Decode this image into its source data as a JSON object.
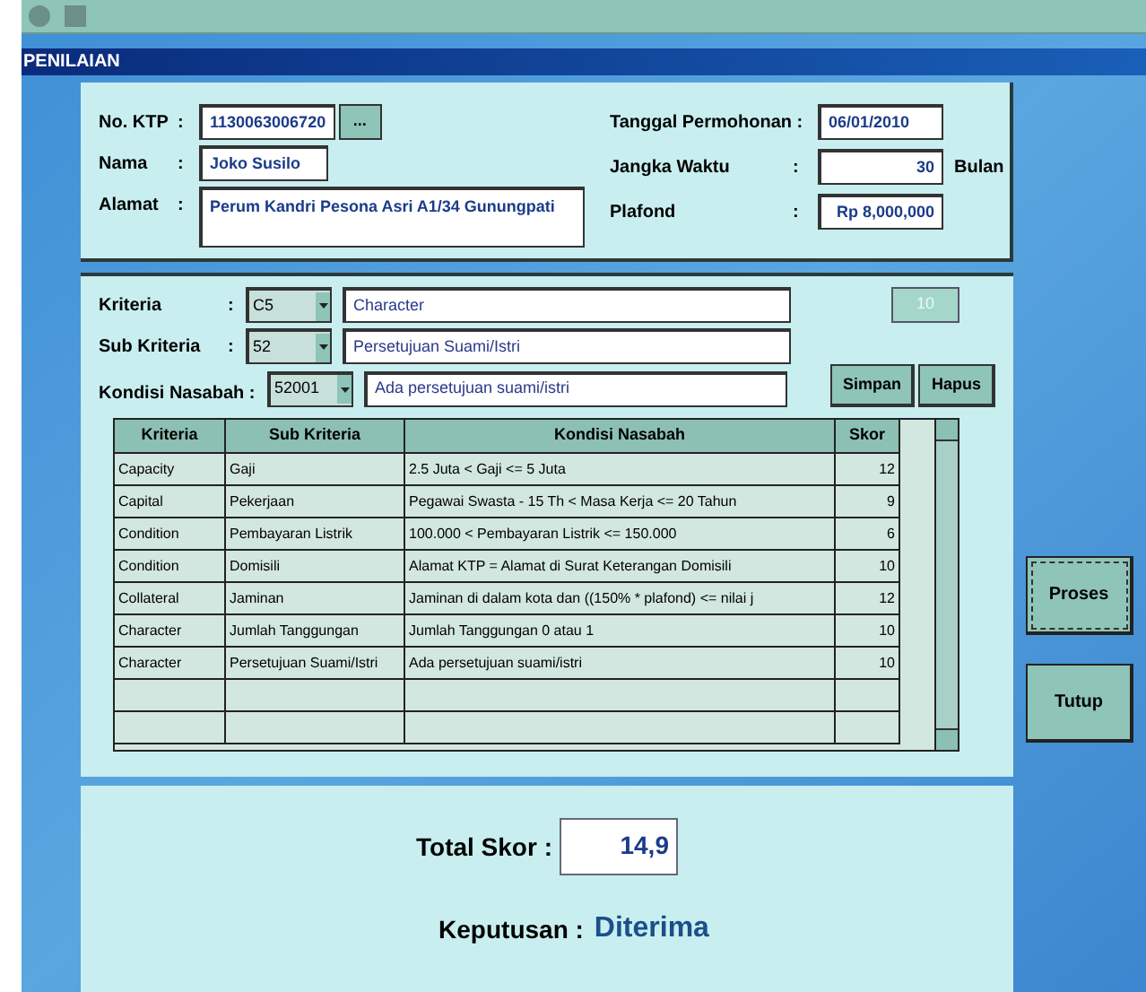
{
  "window": {
    "title": "PENILAIAN"
  },
  "applicant": {
    "ktp": {
      "label": "No. KTP",
      "separator": ":",
      "value": "1130063006720",
      "button": "..."
    },
    "nama": {
      "label": "Nama",
      "separator": ":",
      "value": "Joko Susilo"
    },
    "alamat": {
      "label": "Alamat",
      "separator": ":",
      "value": "Perum Kandri Pesona Asri A1/34 Gunungpati"
    },
    "tanggal": {
      "label": "Tanggal Permohonan :",
      "value": "06/01/2010"
    },
    "jangka": {
      "label": "Jangka Waktu",
      "separator": ":",
      "value": "30",
      "unit": "Bulan"
    },
    "plafond": {
      "label": "Plafond",
      "separator": ":",
      "value": "Rp  8,000,000"
    }
  },
  "criteria_form": {
    "rows": [
      {
        "label": "Kriteria",
        "separator": ":",
        "code": "C5",
        "description": "Character"
      },
      {
        "label": "Sub Kriteria",
        "separator": ":",
        "code": "52",
        "description": "Persetujuan Suami/Istri"
      },
      {
        "label": "Kondisi Nasabah :",
        "code": "52001",
        "description": "Ada persetujuan suami/istri"
      }
    ],
    "score": "10",
    "buttons": [
      "Simpan",
      "Hapus"
    ]
  },
  "table": {
    "columns": [
      "Kriteria",
      "Sub Kriteria",
      "Kondisi Nasabah",
      "Skor"
    ],
    "rows": [
      [
        "Capacity",
        "Gaji",
        "2.5 Juta < Gaji <= 5 Juta",
        "12"
      ],
      [
        "Capital",
        "Pekerjaan",
        "Pegawai Swasta - 15 Th < Masa Kerja <= 20 Tahun",
        "9"
      ],
      [
        "Condition",
        "Pembayaran Listrik",
        "100.000 < Pembayaran Listrik <= 150.000",
        "6"
      ],
      [
        "Condition",
        "Domisili",
        "Alamat KTP = Alamat di Surat Keterangan Domisili",
        "10"
      ],
      [
        "Collateral",
        "Jaminan",
        "Jaminan di dalam kota dan ((150% * plafond) <= nilai j",
        "12"
      ],
      [
        "Character",
        "Jumlah Tanggungan",
        "Jumlah Tanggungan 0 atau 1",
        "10"
      ],
      [
        "Character",
        "Persetujuan Suami/Istri",
        "Ada persetujuan suami/istri",
        "10"
      ]
    ]
  },
  "result": {
    "total_label": "Total Skor  :",
    "total": "14,9",
    "decision_label": "Keputusan :",
    "decision": "Diterima"
  },
  "side_buttons": [
    "Proses",
    "Tutup"
  ]
}
